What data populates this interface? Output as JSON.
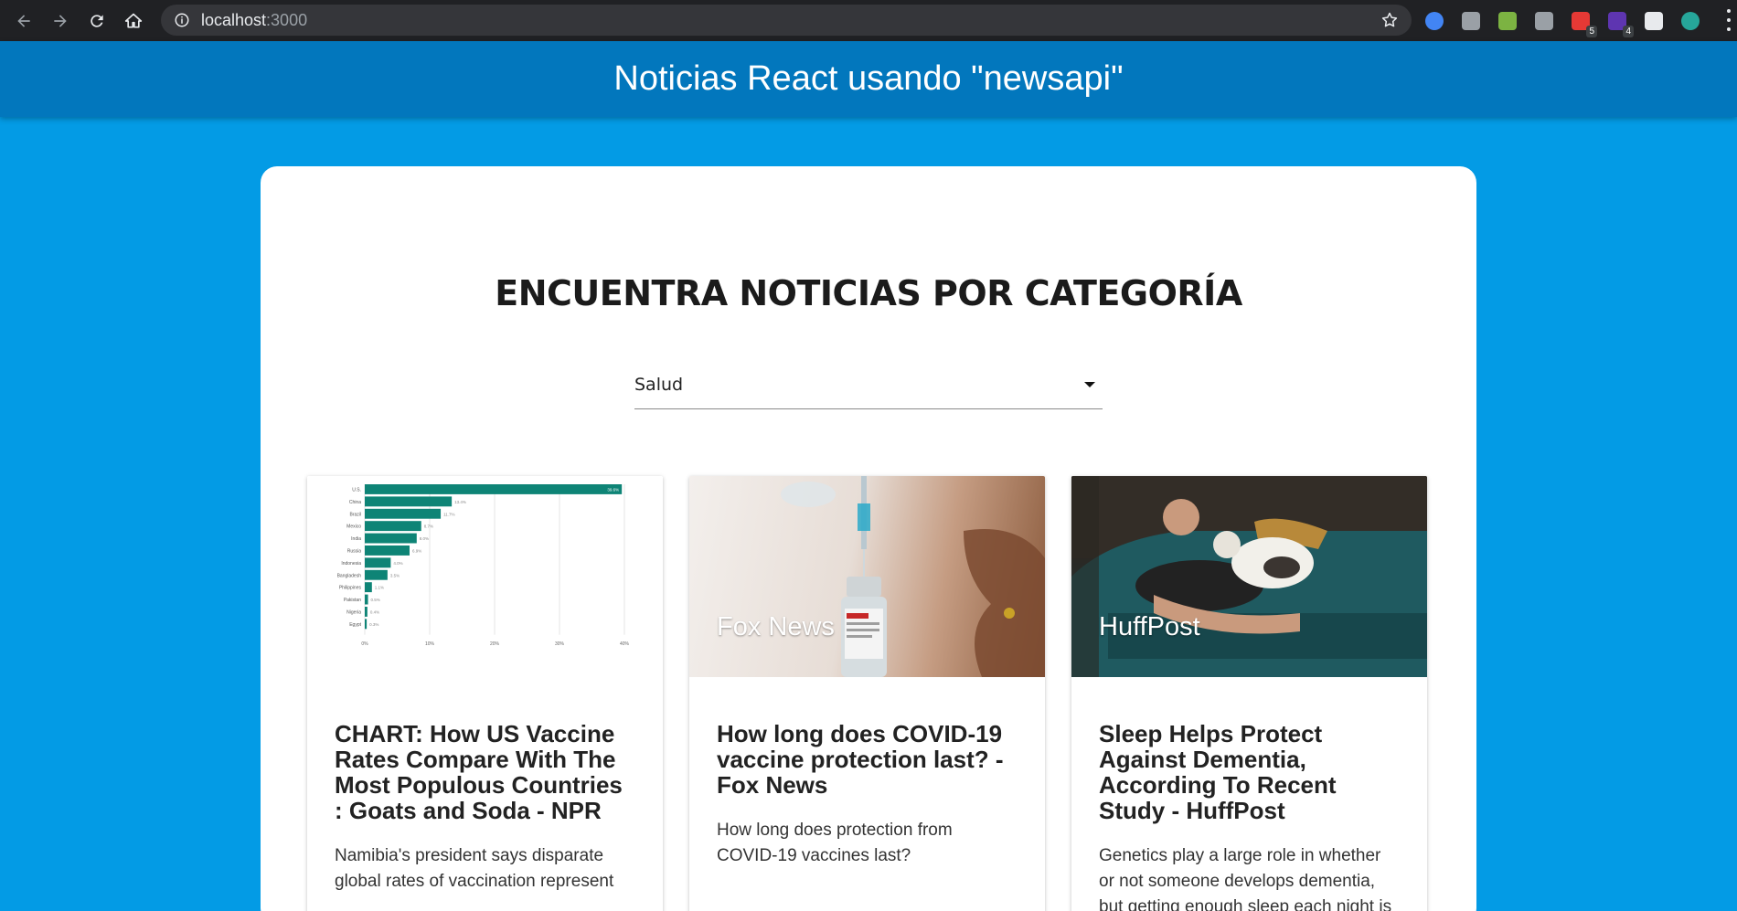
{
  "browser": {
    "url_host": "localhost",
    "url_port": ":3000",
    "extensions": [
      {
        "name": "profile-extension-icon",
        "color": "#4285f4",
        "badge": ""
      },
      {
        "name": "cs-extension-icon",
        "color": "#9aa0a6",
        "badge": ""
      },
      {
        "name": "wave-extension-icon",
        "color": "#7cb342",
        "badge": ""
      },
      {
        "name": "vue-extension-icon",
        "color": "#9aa0a6",
        "badge": ""
      },
      {
        "name": "red-extension-icon",
        "color": "#e53935",
        "badge": "5"
      },
      {
        "name": "purple-extension-icon",
        "color": "#5e35b1",
        "badge": "4"
      },
      {
        "name": "puzzle-extension-icon",
        "color": "#e8eaed",
        "badge": ""
      },
      {
        "name": "avatar-icon",
        "color": "#26a69a",
        "badge": ""
      }
    ]
  },
  "header": {
    "title": "Noticias React usando \"newsapi\""
  },
  "main": {
    "section_title": "ENCUENTRA NOTICIAS POR CATEGORÍA",
    "category_select": {
      "selected": "Salud"
    },
    "news": [
      {
        "source": "",
        "title": "CHART: How US Vaccine Rates Compare With The Most Populous Countries : Goats and Soda - NPR",
        "description": "Namibia's president says disparate global rates of vaccination represent"
      },
      {
        "source": "Fox News",
        "title": "How long does COVID-19 vaccine protection last? - Fox News",
        "description": "How long does protection from COVID-19 vaccines last?"
      },
      {
        "source": "HuffPost",
        "title": "Sleep Helps Protect Against Dementia, According To Recent Study - HuffPost",
        "description": "Genetics play a large role in whether or not someone develops dementia, but getting enough sleep each night is a"
      }
    ]
  },
  "thumbnail_chart": {
    "countries": [
      "U.S.",
      "China",
      "Brazil",
      "Mexico",
      "India",
      "Russia",
      "Indonesia",
      "Bangladesh",
      "Philippines",
      "Pakistan",
      "Nigeria",
      "Egypt"
    ],
    "values": [
      39.6,
      13.4,
      11.7,
      8.7,
      8.0,
      6.9,
      4.0,
      3.5,
      1.1,
      0.5,
      0.4,
      0.3
    ],
    "value_labels": [
      "39.6%",
      "13.4%",
      "11.7%",
      "8.7%",
      "8.0%",
      "6.9%",
      "4.0%",
      "3.5%",
      "1.1%",
      "0.5%",
      "0.4%",
      "0.3%"
    ],
    "ticks": [
      "0%",
      "10%",
      "20%",
      "30%",
      "40%"
    ],
    "bar_color": "#0e8476"
  }
}
